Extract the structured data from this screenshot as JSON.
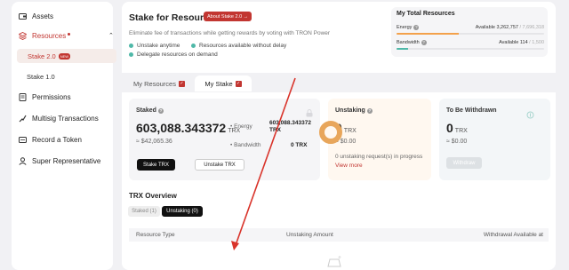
{
  "sidebar": {
    "items": [
      {
        "label": "Assets",
        "icon": "wallet-icon"
      },
      {
        "label": "Resources",
        "icon": "resources-icon"
      },
      {
        "label": "Permissions",
        "icon": "permissions-icon"
      },
      {
        "label": "Multisig Transactions",
        "icon": "multisig-icon"
      },
      {
        "label": "Record a Token",
        "icon": "record-token-icon"
      },
      {
        "label": "Super Representative",
        "icon": "super-rep-icon"
      }
    ],
    "sub": [
      {
        "label": "Stake 2.0",
        "badge": "NEW"
      },
      {
        "label": "Stake 1.0"
      }
    ]
  },
  "header": {
    "title": "Stake for Resources",
    "about_label": "About Stake 2.0 →",
    "subtitle": "Eliminate fee of transactions while getting rewards by voting with TRON Power",
    "features": [
      "Unstake anytime",
      "Resources available without delay",
      "Delegate resources on demand"
    ]
  },
  "total": {
    "title": "My Total Resources",
    "energy": {
      "name": "Energy",
      "available_label": "Available",
      "available": "3,262,757",
      "total": "7,696,318",
      "fraction": 0.42,
      "color": "#f3a14b"
    },
    "bandwidth": {
      "name": "Bandwidth",
      "available_label": "Available",
      "available": "114",
      "total": "1,500",
      "fraction": 0.08,
      "color": "#4fb8a8"
    }
  },
  "tabs": [
    {
      "label": "My Resources"
    },
    {
      "label": "My Stake"
    }
  ],
  "staked": {
    "label": "Staked",
    "amount": "603,088.343372",
    "unit": "TRX",
    "usd": "≈ $42,065.36",
    "energy_label": "Energy",
    "energy_value": "603,088.343372 TRX",
    "bandwidth_label": "Bandwidth",
    "bandwidth_value": "0 TRX",
    "stake_btn": "Stake TRX",
    "unstake_btn": "Unstake TRX"
  },
  "unstaking": {
    "label": "Unstaking",
    "amount": "0",
    "unit": "TRX",
    "usd": "≈ $0.00",
    "requests": "0 unstaking request(s) in progress",
    "view_more": "View more"
  },
  "withdraw": {
    "label": "To Be Withdrawn",
    "amount": "0",
    "unit": "TRX",
    "usd": "≈ $0.00",
    "btn": "Withdraw"
  },
  "overview": {
    "title": "TRX Overview",
    "filters": [
      "Staked (1)",
      "Unstaking (0)"
    ],
    "columns": [
      "Resource Type",
      "Unstaking Amount",
      "Withdrawal Available at"
    ]
  },
  "colors": {
    "accent": "#c23631",
    "teal": "#4fb8a8",
    "orange": "#f3a14b"
  }
}
